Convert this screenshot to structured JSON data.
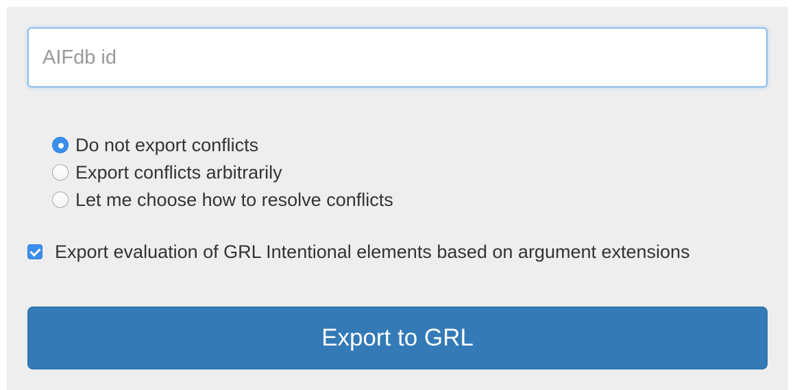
{
  "form": {
    "id_input": {
      "placeholder": "AIFdb id",
      "value": ""
    },
    "conflict_options": [
      {
        "label": "Do not export conflicts",
        "selected": true
      },
      {
        "label": "Export conflicts arbitrarily",
        "selected": false
      },
      {
        "label": "Let me choose how to resolve conflicts",
        "selected": false
      }
    ],
    "evaluation_checkbox": {
      "label": "Export evaluation of GRL Intentional elements based on argument extensions",
      "checked": true
    },
    "export_button_label": "Export to GRL"
  },
  "colors": {
    "panel_background": "#eeeeee",
    "accent": "#3b8eea",
    "button": "#337ab7"
  }
}
